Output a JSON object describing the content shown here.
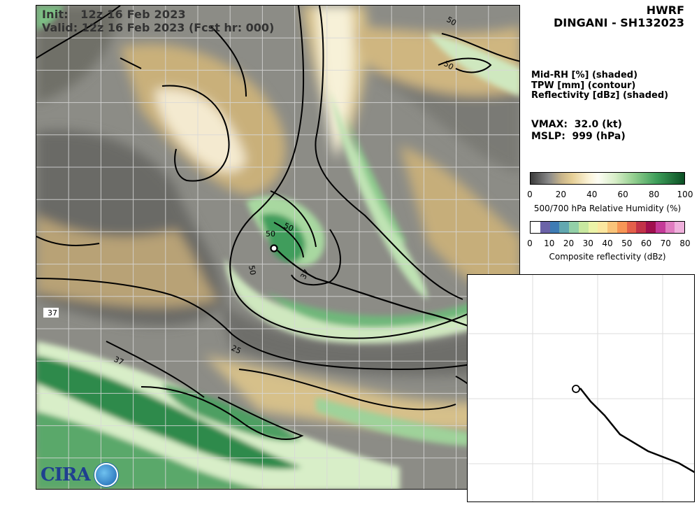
{
  "header": {
    "init_label": "Init:   12z 16 Feb 2023",
    "valid_label": "Valid: 12z 16 Feb 2023 (Fcst hr: 000)",
    "model": "HWRF",
    "storm": "DINGANI - SH132023"
  },
  "legend_text": {
    "line1": "Mid-RH [%] (shaded)",
    "line2": "TPW [mm] (contour)",
    "line3": "Reflectivity [dBz] (shaded)"
  },
  "vitals": {
    "vmax": "VMAX:  32.0 (kt)",
    "mslp": "MSLP:  999 (hPa)"
  },
  "colorbar_rh": {
    "ticks": [
      "0",
      "20",
      "40",
      "60",
      "80",
      "100"
    ],
    "title": "500/700 hPa Relative Humidity (%)"
  },
  "colorbar_refl": {
    "ticks": [
      "0",
      "10",
      "20",
      "30",
      "40",
      "50",
      "60",
      "70",
      "80"
    ],
    "title": "Composite reflectivity (dBz)",
    "colors": [
      "#ffffff",
      "#6b63a8",
      "#3f7cb4",
      "#63a8b0",
      "#93d0a8",
      "#c8e8a0",
      "#ecf3a8",
      "#fbe7a0",
      "#f9c47a",
      "#f79656",
      "#e4604a",
      "#c23349",
      "#a0104f",
      "#c43a98",
      "#e07cc0",
      "#efb0dc"
    ]
  },
  "map": {
    "contour_labels": [
      {
        "text": "50"
      },
      {
        "text": "50"
      },
      {
        "text": "50"
      },
      {
        "text": "50"
      },
      {
        "text": "50"
      },
      {
        "text": "37"
      },
      {
        "text": "37"
      },
      {
        "text": "25"
      },
      {
        "text": "37"
      }
    ],
    "left_label": "37"
  },
  "logo": {
    "text": "CIRA"
  }
}
